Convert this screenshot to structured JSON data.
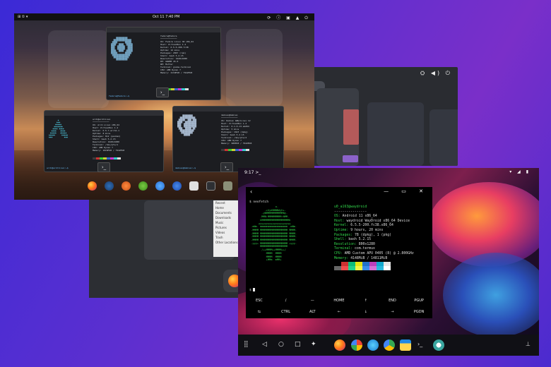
{
  "desktop": {
    "topbar": {
      "left": "⊞  ①  ▾",
      "clock": "Oct 11   7:40 PM",
      "tray": "⟳ ⓘ ▣ ▲ ⏻"
    },
    "terminal_top": {
      "info_lines": [
        "fedora@fedora",
        "─────────────",
        "OS: Fedora Linux 38 x86_64",
        "Host: VirtualBox 1.2",
        "Kernel: 6.5.6-200.fc38",
        "Uptime: 12 mins",
        "Packages: 2067 (rpm)",
        "Shell: bash 5.2.15",
        "Resolution: 1920x1080",
        "DE: GNOME 45.0",
        "WM: Mutter",
        "Terminal: gnome-terminal",
        "CPU: AMD Ryzen 7",
        "Memory: 2134MiB / 7942MiB"
      ]
    },
    "terminal_left": {
      "info_lines": [
        "arch@archlinux",
        "─────────────",
        "OS: Arch Linux x86_64",
        "Host: VirtualBox 1.2",
        "Kernel: 6.5.7-arch1-1",
        "Uptime: 8 mins",
        "Packages: 812 (pacman)",
        "Shell: bash 5.2.15",
        "Resolution: 1920x1080",
        "Terminal: /dev/pts/1",
        "CPU: AMD Ryzen 7",
        "Memory: 1024MiB / 7942MiB"
      ]
    },
    "terminal_right": {
      "info_lines": [
        "debian@debian",
        "─────────────",
        "OS: Debian GNU/Linux 12",
        "Host: VirtualBox 1.2",
        "Kernel: 6.1.0-13-amd64",
        "Uptime: 5 mins",
        "Packages: 1643 (dpkg)",
        "Shell: bash 5.2.15",
        "Terminal: /dev/pts/2",
        "CPU: AMD Ryzen 7",
        "Memory: 980MiB / 7942MiB"
      ]
    },
    "prompt": "fedora@fedora:~$ ",
    "dock_apps": [
      "firefox-icon",
      "steam-icon",
      "ubuntu-icon",
      "maps-icon",
      "chat-icon",
      "thunderbird-icon",
      "store-icon",
      "terminal-icon",
      "files-icon",
      "trash-icon"
    ]
  },
  "files_app": {
    "sidebar": [
      "Recent",
      "Home",
      "Documents",
      "Downloads",
      "Music",
      "Pictures",
      "Videos",
      "Trash",
      "Other Locations"
    ]
  },
  "android": {
    "status": {
      "time": "9:17",
      "left_icon": ">_",
      "right": "▾ ◢ ▮"
    },
    "termux": {
      "command": "$ neofetch",
      "header": "u0_a163@waydroid",
      "separator": "----------------",
      "rows": [
        {
          "k": "OS:",
          "v": "Android 11 x86_64"
        },
        {
          "k": "Host:",
          "v": "waydroid WayDroid x86_64 Device"
        },
        {
          "k": "Kernel:",
          "v": "6.5.5-200.fc38.x86_64"
        },
        {
          "k": "Uptime:",
          "v": "9 hours, 20 mins"
        },
        {
          "k": "Packages:",
          "v": "78 (dpkg), 1 (pkg)"
        },
        {
          "k": "Shell:",
          "v": "bash 5.2.15"
        },
        {
          "k": "Resolution:",
          "v": "800x1280"
        },
        {
          "k": "Terminal:",
          "v": "com.termux"
        },
        {
          "k": "CPU:",
          "v": "AMD Custom APU 0405 (8) @ 2.800GHz"
        },
        {
          "k": "Memory:",
          "v": "4148MiB / 14811MiB"
        }
      ],
      "prompt": "$",
      "keys_row1": [
        "ESC",
        "/",
        "—",
        "HOME",
        "↑",
        "END",
        "PGUP"
      ],
      "keys_row2": [
        "⇆",
        "CTRL",
        "ALT",
        "←",
        "↓",
        "→",
        "PGDN"
      ]
    },
    "nav": {
      "apps_grid": "⣿",
      "back": "◁",
      "home": "○",
      "recents": "□",
      "assistant": "✦",
      "pin": "⊥"
    },
    "dock_apps": [
      "firefox-icon",
      "photos-icon",
      "browser-icon",
      "play-store-icon",
      "calendar-icon",
      "termux-icon",
      "settings-icon"
    ]
  },
  "colors": {
    "background": "#4a2dd0",
    "termux_green": "#32d74b",
    "terminal_blue": "#7fb6d8"
  }
}
